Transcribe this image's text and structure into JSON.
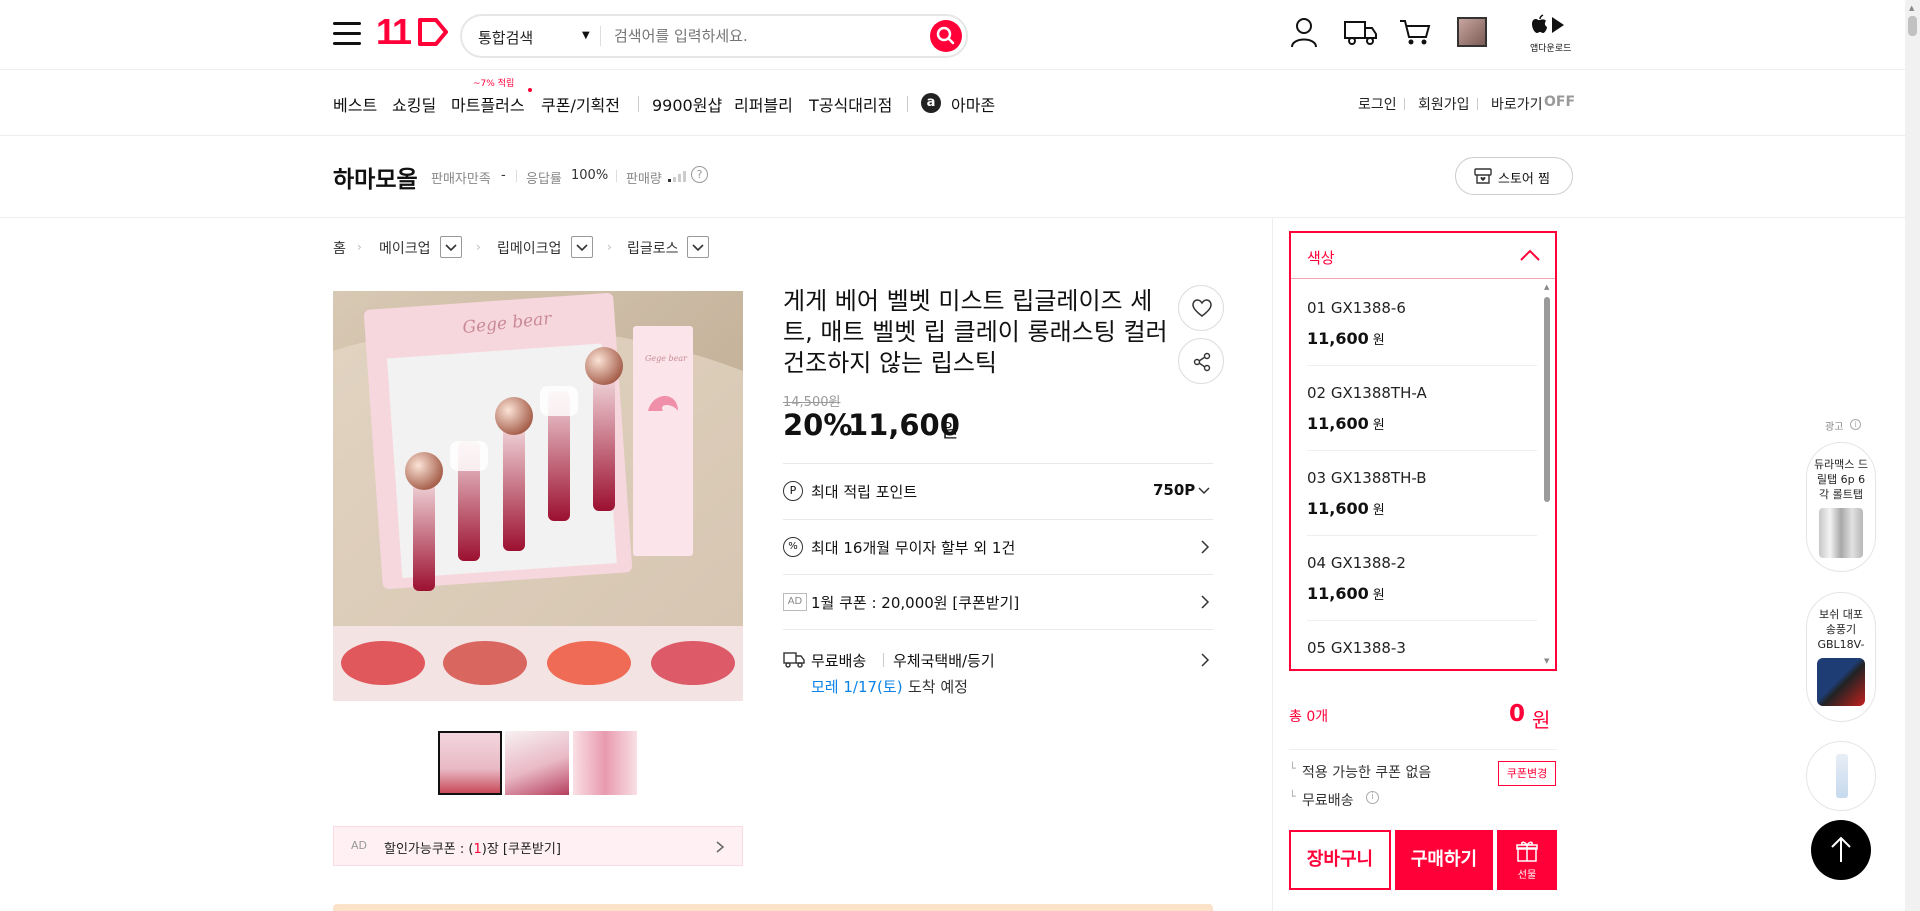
{
  "header": {
    "logo": "11",
    "search_category": "통합검색",
    "search_placeholder": "검색어를 입력하세요.",
    "app_download": "앱다운로드"
  },
  "gnb": {
    "items": [
      "베스트",
      "쇼킹딜",
      "마트플러스",
      "쿠폰/기획전",
      "9900원샵",
      "리퍼블리",
      "T공식대리점",
      "아마존"
    ],
    "mart_badge": "~7% 적립",
    "util": [
      "로그인",
      "회원가입",
      "바로가기",
      "OFF"
    ]
  },
  "store": {
    "name": "하마모올",
    "satisfaction_label": "판매자만족",
    "satisfaction_value": "-",
    "response_label": "응답률",
    "response_value": "100%",
    "sales_label": "판매량",
    "follow_button": "스토어 찜"
  },
  "breadcrumb": [
    "홈",
    "메이크업",
    "립메이크업",
    "립글로스"
  ],
  "product": {
    "image_brand": "Gege bear",
    "title": "게게 베어 벨벳 미스트 립글레이즈 세트, 매트 벨벳 립 클레이 롱래스팅 컬러 건조하지 않는 립스틱",
    "original_price": "14,500원",
    "discount": "20%",
    "price": "11,600",
    "price_unit": "원",
    "points_label": "최대 적립 포인트",
    "points_value": "750P",
    "installment": "최대 16개월 무이자 할부 외 1건",
    "ad_badge": "AD",
    "coupon": "1월 쿠폰 : 20,000원 [쿠폰받기]",
    "shipping_free": "무료배송",
    "shipping_carrier": "우체국택배/등기",
    "arrival_date": "모레 1/17(토)",
    "arrival_suffix": "도착 예정",
    "discount_coupon_ad": "AD",
    "discount_coupon_prefix": "할인가능쿠폰 : (",
    "discount_coupon_count": "1",
    "discount_coupon_suffix": ")장 [쿠폰받기]"
  },
  "options": {
    "header": "색상",
    "items": [
      {
        "name": "01 GX1388-6",
        "price": "11,600",
        "unit": "원"
      },
      {
        "name": "02 GX1388TH-A",
        "price": "11,600",
        "unit": "원"
      },
      {
        "name": "03 GX1388TH-B",
        "price": "11,600",
        "unit": "원"
      },
      {
        "name": "04 GX1388-2",
        "price": "11,600",
        "unit": "원"
      },
      {
        "name": "05 GX1388-3",
        "price": "",
        "unit": ""
      }
    ]
  },
  "summary": {
    "total_label": "총 0개",
    "total_price": "0",
    "total_unit": "원",
    "coupon_none": "적용 가능한 쿠폰 없음",
    "coupon_change": "쿠폰변경",
    "free_shipping": "무료배송",
    "cart_button": "장바구니",
    "buy_button": "구매하기",
    "gift_button": "선물"
  },
  "side_ads": {
    "label": "광고",
    "items": [
      "듀라맥스 드릴탭 6p 6각 롤트탭",
      "보쉬 대포 송풍기 GBL18V-",
      ""
    ]
  },
  "colors": {
    "accent": "#ff0038",
    "link_blue": "#0b83e6"
  }
}
